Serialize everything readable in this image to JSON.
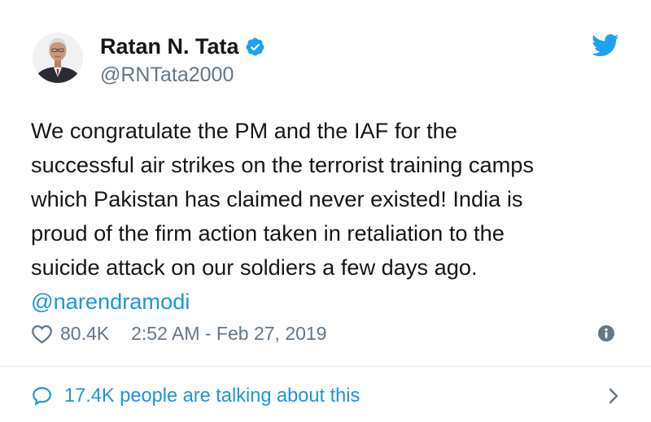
{
  "author": {
    "display_name": "Ratan N. Tata",
    "handle": "@RNTata2000",
    "verified": true
  },
  "tweet": {
    "lines": [
      "We congratulate the PM and the IAF for the",
      "successful air strikes on the terrorist training camps",
      "which Pakistan has claimed never existed! India is",
      "proud of the firm action taken in retaliation to the",
      "suicide attack on our soldiers a few days ago."
    ],
    "mention": "@narendramodi"
  },
  "meta": {
    "likes": "80.4K",
    "timestamp": "2:52 AM - Feb 27, 2019"
  },
  "conversation": {
    "label": "17.4K people are talking about this"
  },
  "colors": {
    "link_blue": "#1b95e0",
    "twitter_blue": "#1da1f2",
    "muted_gray": "#657786",
    "text_dark": "#14171a",
    "divider": "#e1e8ed"
  },
  "icons": {
    "verified": "verified-badge-icon",
    "brand": "twitter-bird-icon",
    "like": "heart-outline-icon",
    "info": "info-circle-icon",
    "reply": "speech-bubble-icon",
    "chevron": "chevron-right-icon"
  }
}
